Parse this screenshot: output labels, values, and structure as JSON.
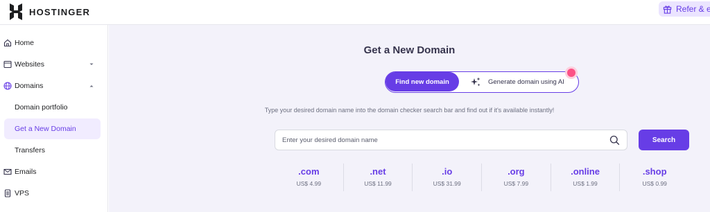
{
  "brand": {
    "name": "HOSTINGER"
  },
  "header": {
    "refer_label": "Refer & earn"
  },
  "sidebar": {
    "items": [
      {
        "label": "Home",
        "icon": "home-icon"
      },
      {
        "label": "Websites",
        "icon": "browser-window-icon"
      },
      {
        "label": "Domains",
        "icon": "globe-icon"
      },
      {
        "label": "Domain portfolio"
      },
      {
        "label": "Get a New Domain"
      },
      {
        "label": "Transfers"
      },
      {
        "label": "Emails",
        "icon": "mail-icon"
      },
      {
        "label": "VPS",
        "icon": "server-icon"
      }
    ]
  },
  "main": {
    "title": "Get a New Domain",
    "toggle": {
      "active": "Find new domain",
      "ai": "Generate domain using AI"
    },
    "subtitle": "Type your desired domain name into the domain checker search bar and find out if it's available instantly!",
    "search": {
      "placeholder": "Enter your desired domain name",
      "button": "Search"
    },
    "tlds": [
      {
        "name": ".com",
        "price": "US$ 4.99"
      },
      {
        "name": ".net",
        "price": "US$ 11.99"
      },
      {
        "name": ".io",
        "price": "US$ 31.99"
      },
      {
        "name": ".org",
        "price": "US$ 7.99"
      },
      {
        "name": ".online",
        "price": "US$ 1.99"
      },
      {
        "name": ".shop",
        "price": "US$ 0.99"
      }
    ]
  },
  "colors": {
    "accent": "#673de6",
    "notification": "#fc5185",
    "background": "#f3f2fa"
  }
}
